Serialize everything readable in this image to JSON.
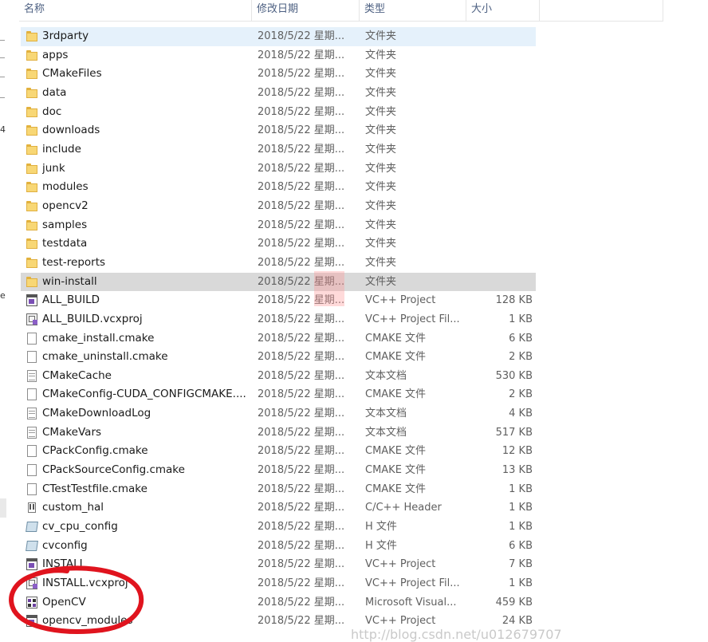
{
  "left_strip": {
    "fragments": [
      "4",
      "e"
    ]
  },
  "columns": {
    "name": "名称",
    "modified": "修改日期",
    "type": "类型",
    "size": "大小",
    "sort_indicator": "^"
  },
  "rows": [
    {
      "name": "3rdparty",
      "date": "2018/5/22 星期...",
      "type": "文件夹",
      "size": "",
      "icon": "folder-icon",
      "state": "selected"
    },
    {
      "name": "apps",
      "date": "2018/5/22 星期...",
      "type": "文件夹",
      "size": "",
      "icon": "folder-icon"
    },
    {
      "name": "CMakeFiles",
      "date": "2018/5/22 星期...",
      "type": "文件夹",
      "size": "",
      "icon": "folder-icon"
    },
    {
      "name": "data",
      "date": "2018/5/22 星期...",
      "type": "文件夹",
      "size": "",
      "icon": "folder-icon"
    },
    {
      "name": "doc",
      "date": "2018/5/22 星期...",
      "type": "文件夹",
      "size": "",
      "icon": "folder-icon"
    },
    {
      "name": "downloads",
      "date": "2018/5/22 星期...",
      "type": "文件夹",
      "size": "",
      "icon": "folder-icon"
    },
    {
      "name": "include",
      "date": "2018/5/22 星期...",
      "type": "文件夹",
      "size": "",
      "icon": "folder-icon"
    },
    {
      "name": "junk",
      "date": "2018/5/22 星期...",
      "type": "文件夹",
      "size": "",
      "icon": "folder-icon"
    },
    {
      "name": "modules",
      "date": "2018/5/22 星期...",
      "type": "文件夹",
      "size": "",
      "icon": "folder-icon"
    },
    {
      "name": "opencv2",
      "date": "2018/5/22 星期...",
      "type": "文件夹",
      "size": "",
      "icon": "folder-icon"
    },
    {
      "name": "samples",
      "date": "2018/5/22 星期...",
      "type": "文件夹",
      "size": "",
      "icon": "folder-icon"
    },
    {
      "name": "testdata",
      "date": "2018/5/22 星期...",
      "type": "文件夹",
      "size": "",
      "icon": "folder-icon"
    },
    {
      "name": "test-reports",
      "date": "2018/5/22 星期...",
      "type": "文件夹",
      "size": "",
      "icon": "folder-icon"
    },
    {
      "name": "win-install",
      "date": "2018/5/22 星期...",
      "type": "文件夹",
      "size": "",
      "icon": "folder-icon",
      "state": "hover"
    },
    {
      "name": "ALL_BUILD",
      "date": "2018/5/22 星期...",
      "type": "VC++ Project",
      "size": "128 KB",
      "icon": "vcx-project-icon"
    },
    {
      "name": "ALL_BUILD.vcxproj",
      "date": "2018/5/22 星期...",
      "type": "VC++ Project Fil...",
      "size": "1 KB",
      "icon": "vcxproj-filters-icon"
    },
    {
      "name": "cmake_install.cmake",
      "date": "2018/5/22 星期...",
      "type": "CMAKE 文件",
      "size": "6 KB",
      "icon": "blank-file-icon"
    },
    {
      "name": "cmake_uninstall.cmake",
      "date": "2018/5/22 星期...",
      "type": "CMAKE 文件",
      "size": "2 KB",
      "icon": "blank-file-icon"
    },
    {
      "name": "CMakeCache",
      "date": "2018/5/22 星期...",
      "type": "文本文档",
      "size": "530 KB",
      "icon": "text-file-icon"
    },
    {
      "name": "CMakeConfig-CUDA_CONFIGCMAKE....",
      "date": "2018/5/22 星期...",
      "type": "CMAKE 文件",
      "size": "2 KB",
      "icon": "blank-file-icon"
    },
    {
      "name": "CMakeDownloadLog",
      "date": "2018/5/22 星期...",
      "type": "文本文档",
      "size": "4 KB",
      "icon": "text-file-icon"
    },
    {
      "name": "CMakeVars",
      "date": "2018/5/22 星期...",
      "type": "文本文档",
      "size": "517 KB",
      "icon": "text-file-icon"
    },
    {
      "name": "CPackConfig.cmake",
      "date": "2018/5/22 星期...",
      "type": "CMAKE 文件",
      "size": "12 KB",
      "icon": "blank-file-icon"
    },
    {
      "name": "CPackSourceConfig.cmake",
      "date": "2018/5/22 星期...",
      "type": "CMAKE 文件",
      "size": "13 KB",
      "icon": "blank-file-icon"
    },
    {
      "name": "CTestTestfile.cmake",
      "date": "2018/5/22 星期...",
      "type": "CMAKE 文件",
      "size": "1 KB",
      "icon": "blank-file-icon"
    },
    {
      "name": "custom_hal",
      "date": "2018/5/22 星期...",
      "type": "C/C++ Header",
      "size": "1 KB",
      "icon": "c-header-icon"
    },
    {
      "name": "cv_cpu_config",
      "date": "2018/5/22 星期...",
      "type": "H 文件",
      "size": "1 KB",
      "icon": "h-file-icon"
    },
    {
      "name": "cvconfig",
      "date": "2018/5/22 星期...",
      "type": "H 文件",
      "size": "6 KB",
      "icon": "h-file-icon"
    },
    {
      "name": "INSTALL",
      "date": "2018/5/22 星期...",
      "type": "VC++ Project",
      "size": "7 KB",
      "icon": "vcx-project-icon"
    },
    {
      "name": "INSTALL.vcxproj",
      "date": "2018/5/22 星期...",
      "type": "VC++ Project Fil...",
      "size": "1 KB",
      "icon": "vcxproj-filters-icon"
    },
    {
      "name": "OpenCV",
      "date": "2018/5/22 星期...",
      "type": "Microsoft Visual...",
      "size": "459 KB",
      "icon": "solution-icon"
    },
    {
      "name": "opencv_modules",
      "date": "2018/5/22 星期...",
      "type": "VC++ Project",
      "size": "24 KB",
      "icon": "vcx-project-icon"
    }
  ],
  "watermark": "http://blog.csdn.net/u012679707",
  "colors": {
    "selected": "#e5f1fb",
    "hover": "#d9d9d9",
    "header_text": "#4d6082",
    "annotation_red": "#e0141e"
  }
}
